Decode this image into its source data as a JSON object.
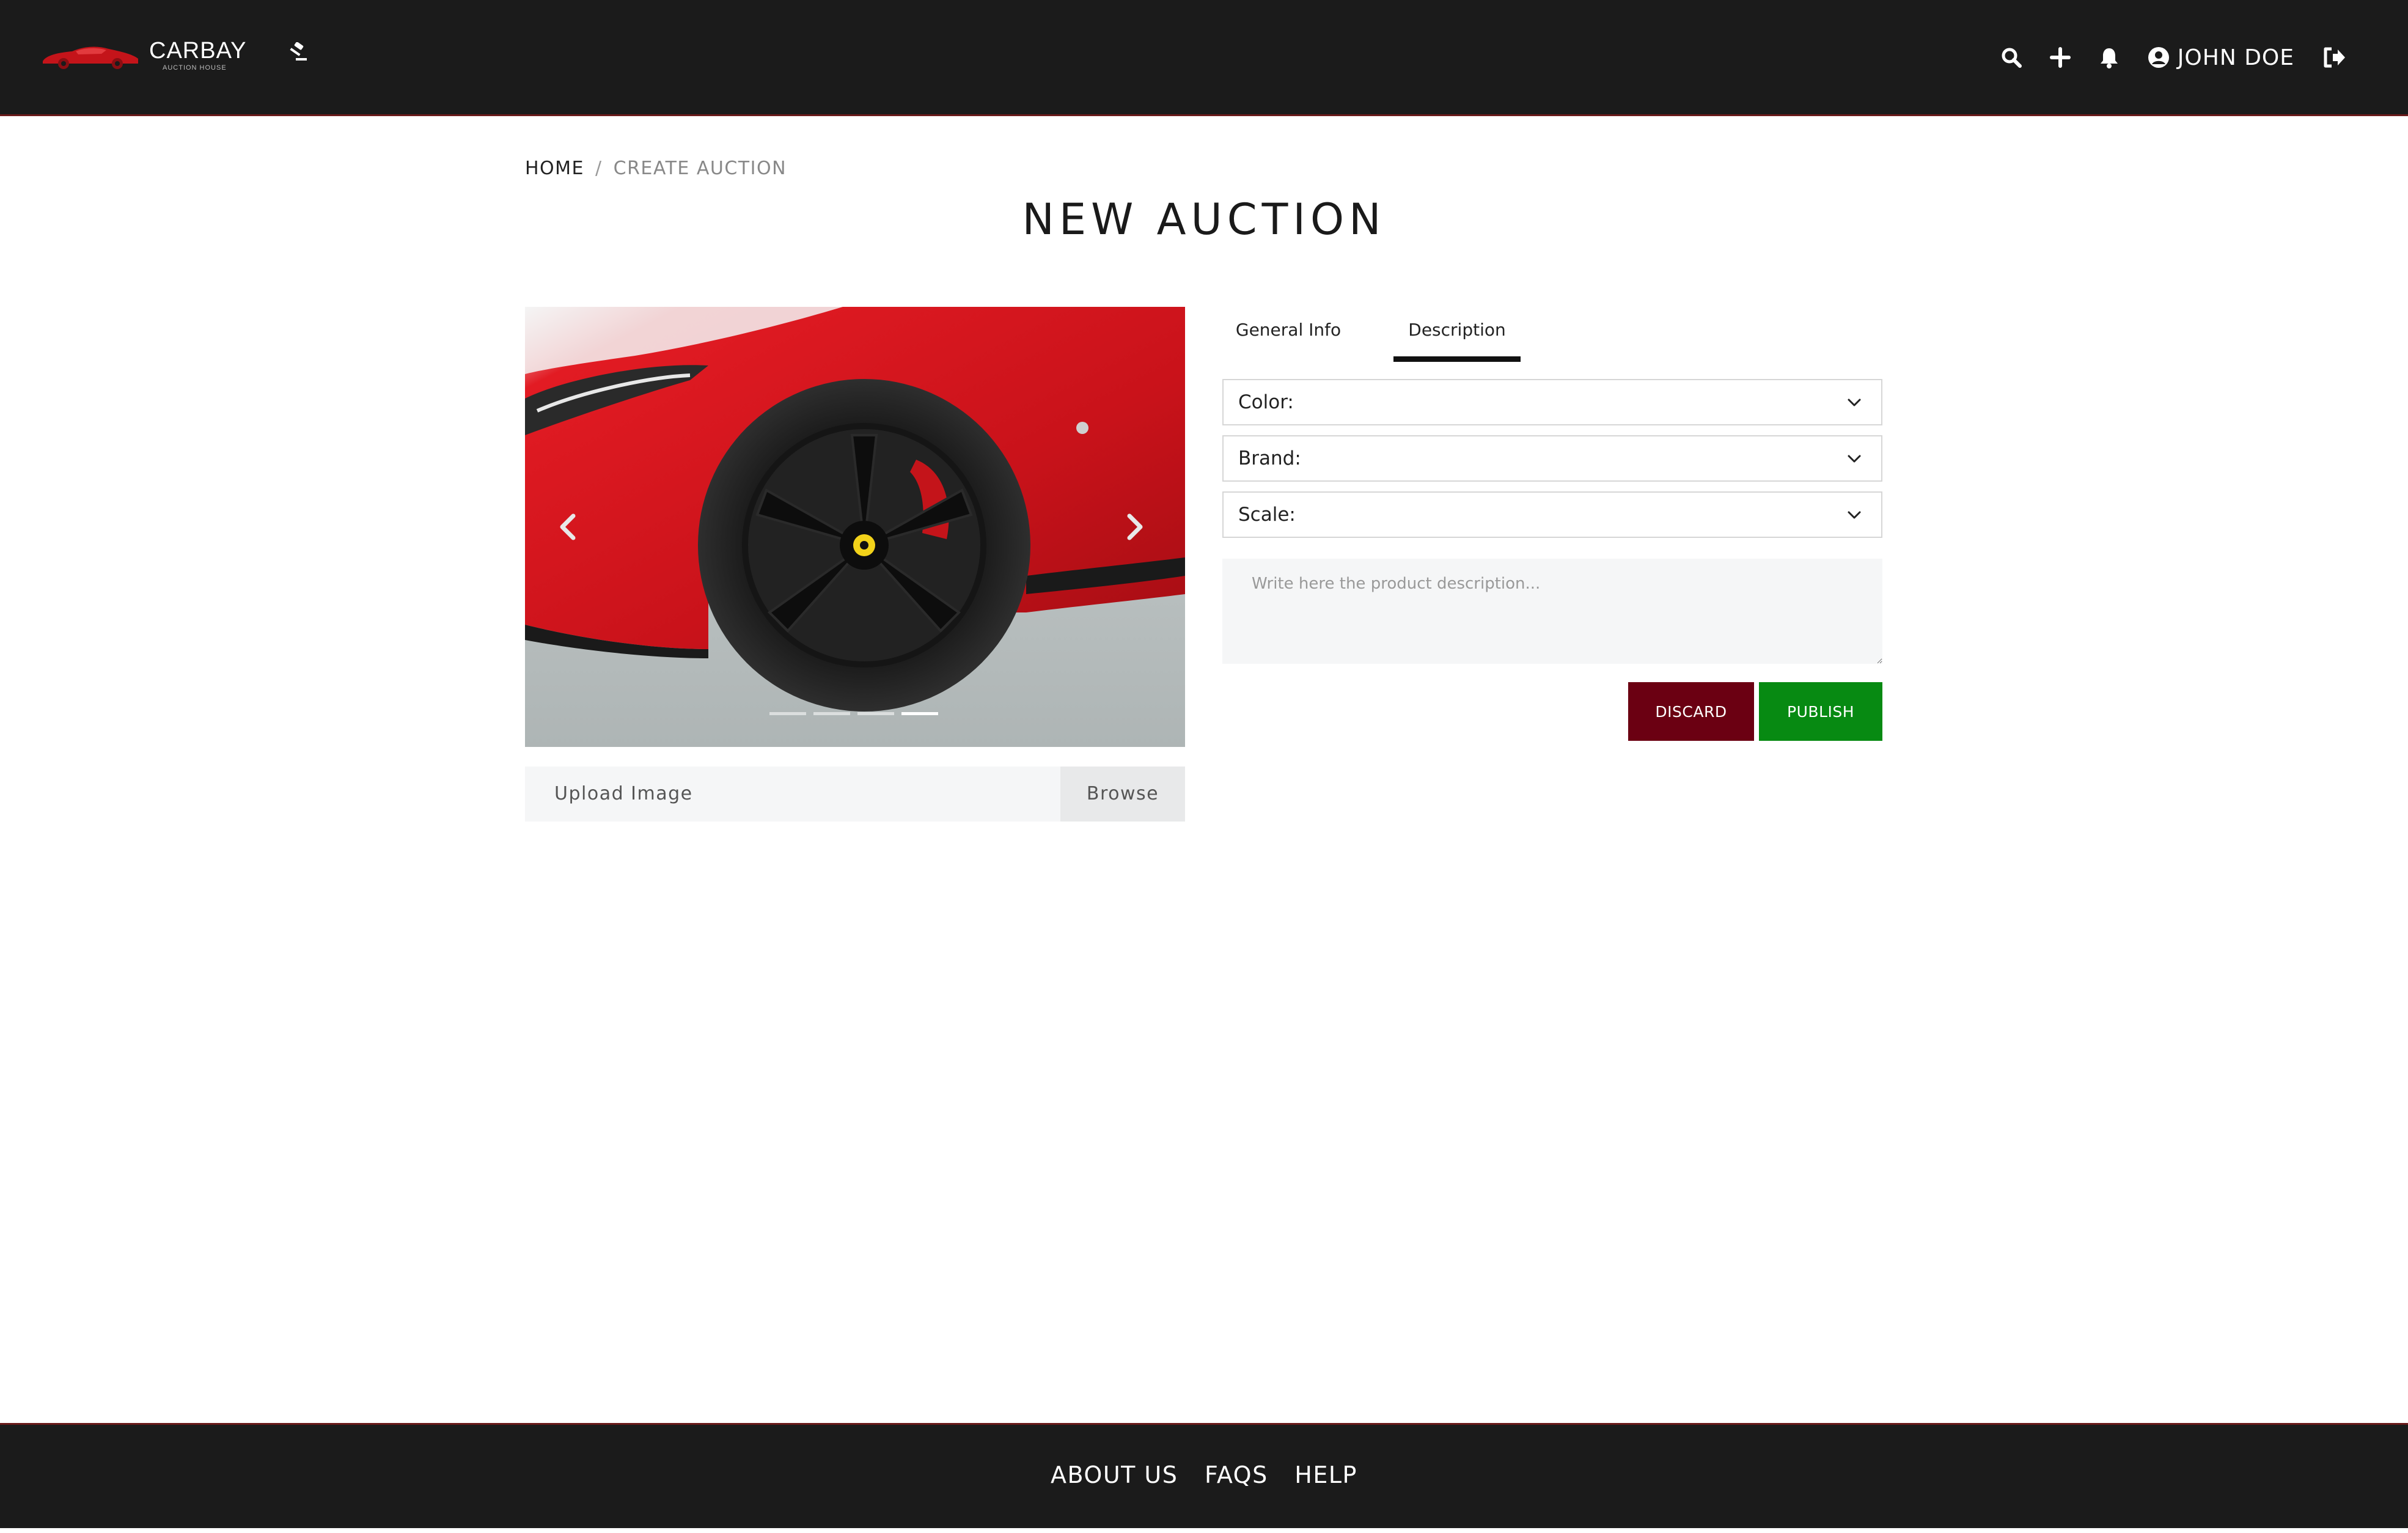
{
  "header": {
    "logo_brand": "CARBAY",
    "logo_tagline": "AUCTION HOUSE",
    "user_name": "JOHN DOE",
    "icons": [
      "search-icon",
      "plus-icon",
      "bell-icon",
      "user-circle-icon",
      "sign-out-icon"
    ]
  },
  "breadcrumb": {
    "home": "HOME",
    "separator": "/",
    "current": "CREATE AUCTION"
  },
  "page_title": "NEW AUCTION",
  "carousel": {
    "slide_count": 4,
    "active_slide": 4
  },
  "upload": {
    "label": "Upload Image",
    "browse_label": "Browse"
  },
  "tabs": [
    {
      "label": "General Info",
      "active": false
    },
    {
      "label": "Description",
      "active": true
    }
  ],
  "form": {
    "color_label": "Color:",
    "brand_label": "Brand:",
    "scale_label": "Scale:",
    "description_placeholder": "Write here the product description...",
    "discard_label": "DISCARD",
    "publish_label": "PUBLISH"
  },
  "footer": {
    "links": [
      "ABOUT US",
      "FAQS",
      "HELP"
    ]
  },
  "colors": {
    "header_bg": "#1b1b1b",
    "discard": "#6b0012",
    "publish": "#078a12",
    "accent_red": "#d9161c"
  }
}
